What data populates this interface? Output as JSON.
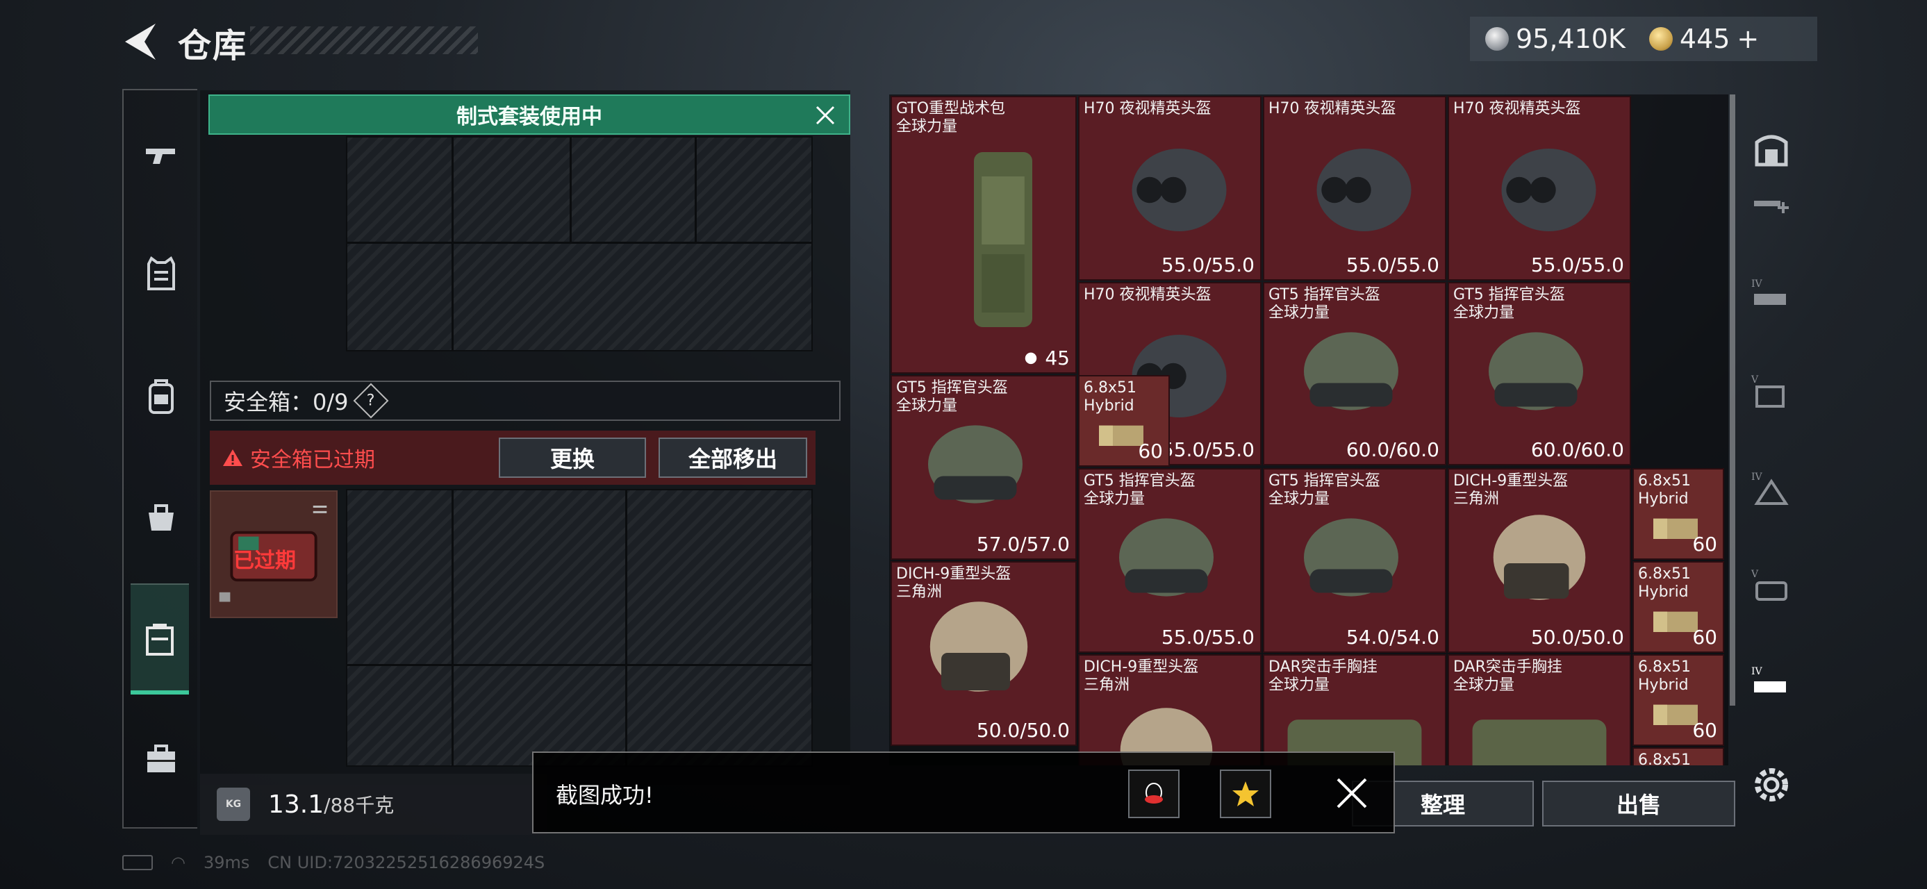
{
  "header": {
    "title": "仓库"
  },
  "currency": {
    "silver": "95,410K",
    "gold": "445",
    "gold_plus": "+"
  },
  "sidebar": {
    "items": [
      {
        "icon": "pistol-icon"
      },
      {
        "icon": "vest-icon"
      },
      {
        "icon": "backpack-icon"
      },
      {
        "icon": "bag-icon"
      },
      {
        "icon": "safebox-icon",
        "active": true
      },
      {
        "icon": "briefcase-icon"
      }
    ]
  },
  "left_panel": {
    "suit_banner": "制式套装使用中",
    "safebox_label": "安全箱：0/9",
    "help": "?",
    "expired_text": "安全箱已过期",
    "replace_label": "更换",
    "remove_all_label": "全部移出",
    "safebox_item_label": "已过期",
    "weight_unit_icon": "KG",
    "weight_value": "13.1",
    "weight_max": "/88千克"
  },
  "stash": {
    "items": [
      {
        "name": "GTO重型战术包\n全球力量",
        "count": "45",
        "art": "backpack"
      },
      {
        "name": "H70 夜视精英头盔",
        "durability": "55.0/55.0",
        "art": "nvg"
      },
      {
        "name": "H70 夜视精英头盔",
        "durability": "55.0/55.0",
        "art": "nvg"
      },
      {
        "name": "H70 夜视精英头盔",
        "durability": "55.0/55.0",
        "art": "nvg"
      },
      {
        "name": "H70 夜视精英头盔",
        "durability": "55.0/55.0",
        "art": "nvg"
      },
      {
        "name": "GT5 指挥官头盔\n全球力量",
        "durability": "60.0/60.0",
        "art": "gt5"
      },
      {
        "name": "GT5 指挥官头盔\n全球力量",
        "durability": "60.0/60.0",
        "art": "gt5"
      },
      {
        "name": "GT5 指挥官头盔\n全球力量",
        "durability": "57.0/57.0",
        "art": "gt5"
      },
      {
        "name": "6.8x51\nHybrid",
        "count": "60",
        "art": "ammo"
      },
      {
        "name": "GT5 指挥官头盔\n全球力量",
        "durability": "55.0/55.0",
        "art": "gt5"
      },
      {
        "name": "GT5 指挥官头盔\n全球力量",
        "durability": "54.0/54.0",
        "art": "gt5"
      },
      {
        "name": "DICH-9重型头盔\n三角洲",
        "durability": "50.0/50.0",
        "art": "dich"
      },
      {
        "name": "6.8x51\nHybrid",
        "count": "60",
        "art": "ammo"
      },
      {
        "name": "DICH-9重型头盔\n三角洲",
        "durability": "50.0/50.0",
        "art": "dich"
      },
      {
        "name": "6.8x51\nHybrid",
        "count": "60",
        "art": "ammo"
      },
      {
        "name": "DICH-9重型头盔\n三角洲",
        "art": "dich"
      },
      {
        "name": "DAR突击手胸挂\n全球力量",
        "art": "rig"
      },
      {
        "name": "DAR突击手胸挂\n全球力量",
        "art": "rig"
      },
      {
        "name": "6.8x51\nHybrid",
        "count": "60",
        "art": "ammo"
      },
      {
        "name": "6.8x51",
        "art": "ammo"
      }
    ]
  },
  "bottom_buttons": {
    "sort_label": "整理",
    "sell_label": "出售"
  },
  "toast": {
    "message": "截图成功!"
  },
  "status_bar": {
    "ping": "39ms",
    "uid": "CN UID:7203225251628696924S"
  },
  "colors": {
    "accent_green": "#1f7a5a",
    "item_bg": "#5a1d24",
    "expired_red": "#ff4d4d"
  }
}
